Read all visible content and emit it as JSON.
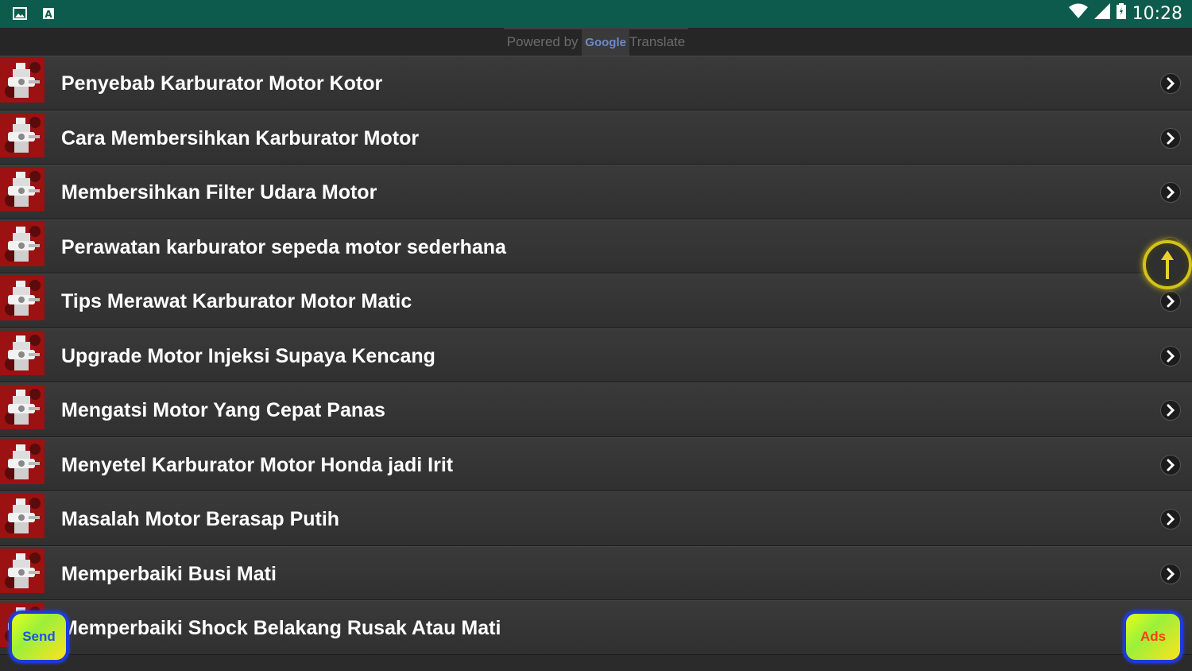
{
  "statusbar": {
    "time": "10:28",
    "left_icons": [
      "image-icon",
      "a-icon"
    ],
    "right_icons": [
      "wifi-icon",
      "signal-icon",
      "battery-icon"
    ]
  },
  "translate_bar": {
    "powered_by": "Powered by",
    "google": "Google",
    "translate": "Translate"
  },
  "list": {
    "items": [
      {
        "label": "Penyebab Karburator Motor Kotor"
      },
      {
        "label": "Cara Membersihkan Karburator Motor"
      },
      {
        "label": "Membersihkan Filter Udara Motor"
      },
      {
        "label": "Perawatan karburator sepeda motor sederhana"
      },
      {
        "label": "Tips Merawat Karburator Motor Matic"
      },
      {
        "label": "Upgrade Motor Injeksi Supaya Kencang"
      },
      {
        "label": "Mengatsi Motor Yang Cepat Panas"
      },
      {
        "label": "Menyetel Karburator Motor Honda jadi Irit"
      },
      {
        "label": "Masalah Motor Berasap Putih"
      },
      {
        "label": "Memperbaiki Busi Mati"
      },
      {
        "label": "Memperbaiki Shock Belakang Rusak Atau Mati"
      }
    ]
  },
  "buttons": {
    "send": "Send",
    "ads": "Ads"
  },
  "colors": {
    "statusbar": "#0d5b4d",
    "row_bg": "#363636",
    "accent_fab": "#d2c21a"
  }
}
